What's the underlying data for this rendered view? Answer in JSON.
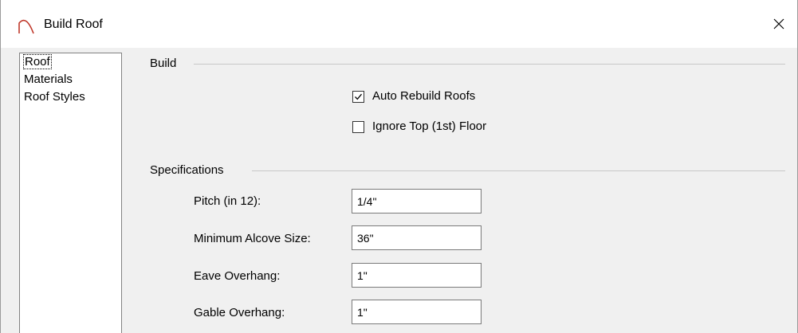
{
  "window": {
    "title": "Build Roof"
  },
  "icons": {
    "app": "roof-arc-icon",
    "close": "close-icon",
    "check": "checkmark-icon"
  },
  "nav": {
    "items": [
      {
        "label": "Roof",
        "selected": true
      },
      {
        "label": "Materials",
        "selected": false
      },
      {
        "label": "Roof Styles",
        "selected": false
      }
    ]
  },
  "build": {
    "title": "Build",
    "auto_rebuild": {
      "label": "Auto Rebuild Roofs",
      "checked": true
    },
    "ignore_top": {
      "label": "Ignore Top (1st) Floor",
      "checked": false
    }
  },
  "specifications": {
    "title": "Specifications",
    "pitch": {
      "label": "Pitch (in 12):",
      "value": "1/4\""
    },
    "alcove": {
      "label": "Minimum Alcove Size:",
      "value": "36\""
    },
    "eave": {
      "label": "Eave Overhang:",
      "value": "1\""
    },
    "gable": {
      "label": "Gable Overhang:",
      "value": "1\""
    }
  },
  "colors": {
    "window_bg": "#f0f0f0",
    "titlebar_bg": "#ffffff",
    "icon_accent": "#c0392b"
  }
}
